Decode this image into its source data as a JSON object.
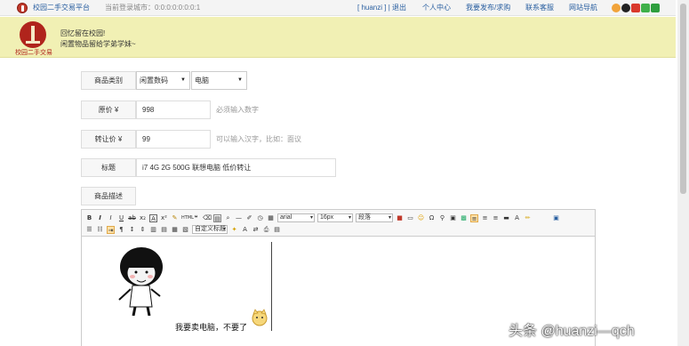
{
  "topbar": {
    "site_name": "校园二手交易平台",
    "city_label": "当前登录城市：0:0:0:0:0:0:0:1",
    "user_links": "[ huanzi ] | 退出",
    "nav_personal": "个人中心",
    "nav_publish": "我要发布/求购",
    "nav_service": "联系客服",
    "nav_sitemap": "网站导航"
  },
  "banner": {
    "logo_text": "校园二手交易",
    "slogan_line1": "回忆留在校园!",
    "slogan_line2": "闲置物品留给学弟学妹~"
  },
  "form": {
    "category": {
      "label": "商品类别",
      "option1": "闲置数码",
      "option2": "电脑"
    },
    "original_price": {
      "label": "原价 ¥",
      "value": "998",
      "hint": "必须输入数字"
    },
    "transfer_price": {
      "label": "转让价 ¥",
      "value": "99",
      "hint": "可以输入汉字，比如：面议"
    },
    "title": {
      "label": "标题",
      "value": "i7 4G 2G 500G 联想电脑 低价转让"
    },
    "description": {
      "label": "商品描述"
    }
  },
  "editor": {
    "font_family": "arial",
    "font_size": "16px",
    "paragraph": "段落",
    "custom_title": "自定义标题",
    "caption": "我要卖电脑，不要了"
  },
  "watermark": "头条 @huanzi—qch"
}
